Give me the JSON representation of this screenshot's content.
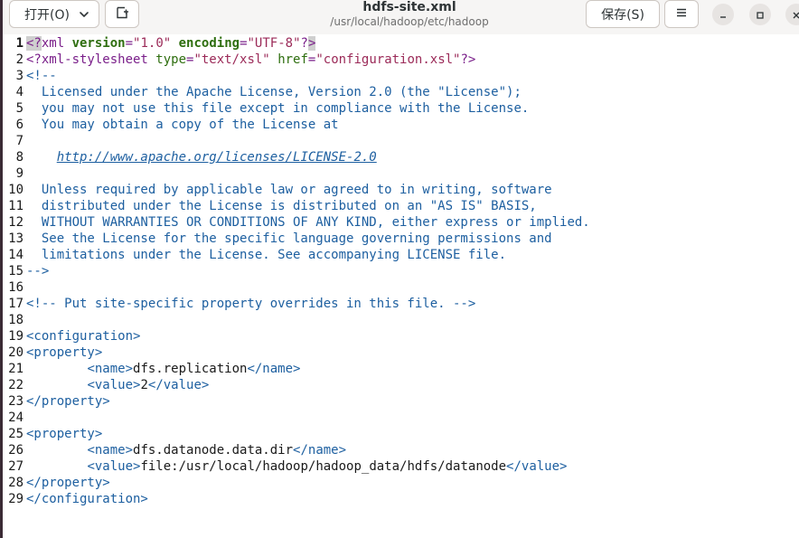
{
  "header": {
    "open_label": "打开(O)",
    "save_label": "保存(S)",
    "title": "hdfs-site.xml",
    "path": "/usr/local/hadoop/etc/hadoop"
  },
  "editor": {
    "current_line": 1,
    "lines": [
      {
        "n": "1",
        "tokens": [
          {
            "t": "<?",
            "c": "tok-pi-hl"
          },
          {
            "t": "xml ",
            "c": "tok-pi"
          },
          {
            "t": "version",
            "c": "tok-attr"
          },
          {
            "t": "=",
            "c": "tok-pi"
          },
          {
            "t": "\"1.0\"",
            "c": "tok-str"
          },
          {
            "t": " ",
            "c": "tok-pi"
          },
          {
            "t": "encoding",
            "c": "tok-attr"
          },
          {
            "t": "=",
            "c": "tok-pi"
          },
          {
            "t": "\"UTF-8\"",
            "c": "tok-str"
          },
          {
            "t": "?",
            "c": "tok-pi"
          },
          {
            "t": ">",
            "c": "tok-pi-hl"
          }
        ]
      },
      {
        "n": "2",
        "tokens": [
          {
            "t": "<?xml-stylesheet ",
            "c": "tok-pi"
          },
          {
            "t": "type",
            "c": "tok-attr2"
          },
          {
            "t": "=",
            "c": "tok-pi"
          },
          {
            "t": "\"text/xsl\"",
            "c": "tok-str"
          },
          {
            "t": " ",
            "c": "tok-pi"
          },
          {
            "t": "href",
            "c": "tok-attr2"
          },
          {
            "t": "=",
            "c": "tok-pi"
          },
          {
            "t": "\"configuration.xsl\"",
            "c": "tok-str"
          },
          {
            "t": "?>",
            "c": "tok-pi"
          }
        ]
      },
      {
        "n": "3",
        "tokens": [
          {
            "t": "<!--",
            "c": "tok-comment"
          }
        ]
      },
      {
        "n": "4",
        "tokens": [
          {
            "t": "  Licensed under the Apache License, Version 2.0 (the \"License\");",
            "c": "tok-comment"
          }
        ]
      },
      {
        "n": "5",
        "tokens": [
          {
            "t": "  you may not use this file except in compliance with the License.",
            "c": "tok-comment"
          }
        ]
      },
      {
        "n": "6",
        "tokens": [
          {
            "t": "  You may obtain a copy of the License at",
            "c": "tok-comment"
          }
        ]
      },
      {
        "n": "7",
        "tokens": []
      },
      {
        "n": "8",
        "tokens": [
          {
            "t": "    ",
            "c": "tok-comment"
          },
          {
            "t": "http://www.apache.org/licenses/LICENSE-2.0",
            "c": "tok-link"
          }
        ]
      },
      {
        "n": "9",
        "tokens": []
      },
      {
        "n": "10",
        "tokens": [
          {
            "t": "  Unless required by applicable law or agreed to in writing, software",
            "c": "tok-comment"
          }
        ]
      },
      {
        "n": "11",
        "tokens": [
          {
            "t": "  distributed under the License is distributed on an \"AS IS\" BASIS,",
            "c": "tok-comment"
          }
        ]
      },
      {
        "n": "12",
        "tokens": [
          {
            "t": "  WITHOUT WARRANTIES OR CONDITIONS OF ANY KIND, either express or implied.",
            "c": "tok-comment"
          }
        ]
      },
      {
        "n": "13",
        "tokens": [
          {
            "t": "  See the License for the specific language governing permissions and",
            "c": "tok-comment"
          }
        ]
      },
      {
        "n": "14",
        "tokens": [
          {
            "t": "  limitations under the License. See accompanying LICENSE file.",
            "c": "tok-comment"
          }
        ]
      },
      {
        "n": "15",
        "tokens": [
          {
            "t": "-->",
            "c": "tok-comment"
          }
        ]
      },
      {
        "n": "16",
        "tokens": []
      },
      {
        "n": "17",
        "tokens": [
          {
            "t": "<!-- Put site-specific property overrides in this file. -->",
            "c": "tok-comment"
          }
        ]
      },
      {
        "n": "18",
        "tokens": []
      },
      {
        "n": "19",
        "tokens": [
          {
            "t": "<configuration>",
            "c": "tok-tag"
          }
        ]
      },
      {
        "n": "20",
        "tokens": [
          {
            "t": "<property>",
            "c": "tok-tag"
          }
        ]
      },
      {
        "n": "21",
        "tokens": [
          {
            "t": "        ",
            "c": "tok-text"
          },
          {
            "t": "<name>",
            "c": "tok-tag"
          },
          {
            "t": "dfs.replication",
            "c": "tok-text"
          },
          {
            "t": "</name>",
            "c": "tok-tag"
          }
        ]
      },
      {
        "n": "22",
        "tokens": [
          {
            "t": "        ",
            "c": "tok-text"
          },
          {
            "t": "<value>",
            "c": "tok-tag"
          },
          {
            "t": "2",
            "c": "tok-text"
          },
          {
            "t": "</value>",
            "c": "tok-tag"
          }
        ]
      },
      {
        "n": "23",
        "tokens": [
          {
            "t": "</property>",
            "c": "tok-tag"
          }
        ]
      },
      {
        "n": "24",
        "tokens": []
      },
      {
        "n": "25",
        "tokens": [
          {
            "t": "<property>",
            "c": "tok-tag"
          }
        ]
      },
      {
        "n": "26",
        "tokens": [
          {
            "t": "        ",
            "c": "tok-text"
          },
          {
            "t": "<name>",
            "c": "tok-tag"
          },
          {
            "t": "dfs.datanode.data.dir",
            "c": "tok-text"
          },
          {
            "t": "</name>",
            "c": "tok-tag"
          }
        ]
      },
      {
        "n": "27",
        "tokens": [
          {
            "t": "        ",
            "c": "tok-text"
          },
          {
            "t": "<value>",
            "c": "tok-tag"
          },
          {
            "t": "file:/usr/local/hadoop/hadoop_data/hdfs/datanode",
            "c": "tok-text"
          },
          {
            "t": "</value>",
            "c": "tok-tag"
          }
        ]
      },
      {
        "n": "28",
        "tokens": [
          {
            "t": "</property>",
            "c": "tok-tag"
          }
        ]
      },
      {
        "n": "29",
        "tokens": [
          {
            "t": "</configuration>",
            "c": "tok-tag"
          }
        ]
      }
    ]
  }
}
